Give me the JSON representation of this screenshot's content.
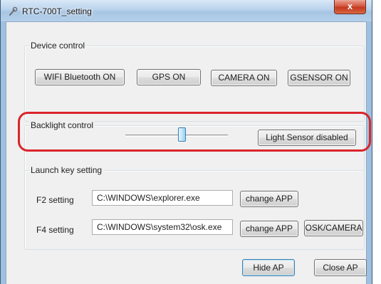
{
  "window": {
    "title": "RTC-700T_setting",
    "close_glyph": "x",
    "colors": {
      "highlight": "#d9252b",
      "titlebar": "#b9d2ec",
      "client": "#f0f0f0"
    }
  },
  "device_control": {
    "title": "Device control",
    "buttons": [
      "WIFI  Bluetooth ON",
      "GPS ON",
      "CAMERA ON",
      "GSENSOR ON"
    ]
  },
  "backlight": {
    "title": "Backlight control",
    "level": 0.55,
    "light_sensor_button": "Light Sensor disabled"
  },
  "launch_keys": {
    "title": "Launch key setting",
    "f2": {
      "label": "F2 setting",
      "path": "C:\\WINDOWS\\explorer.exe",
      "change_button": "change APP"
    },
    "f4": {
      "label": "F4 setting",
      "path": "C:\\WINDOWS\\system32\\osk.exe",
      "change_button": "change APP",
      "extra_button": "OSK/CAMERA"
    }
  },
  "footer": {
    "hide_button": "Hide AP",
    "close_button": "Close AP"
  }
}
